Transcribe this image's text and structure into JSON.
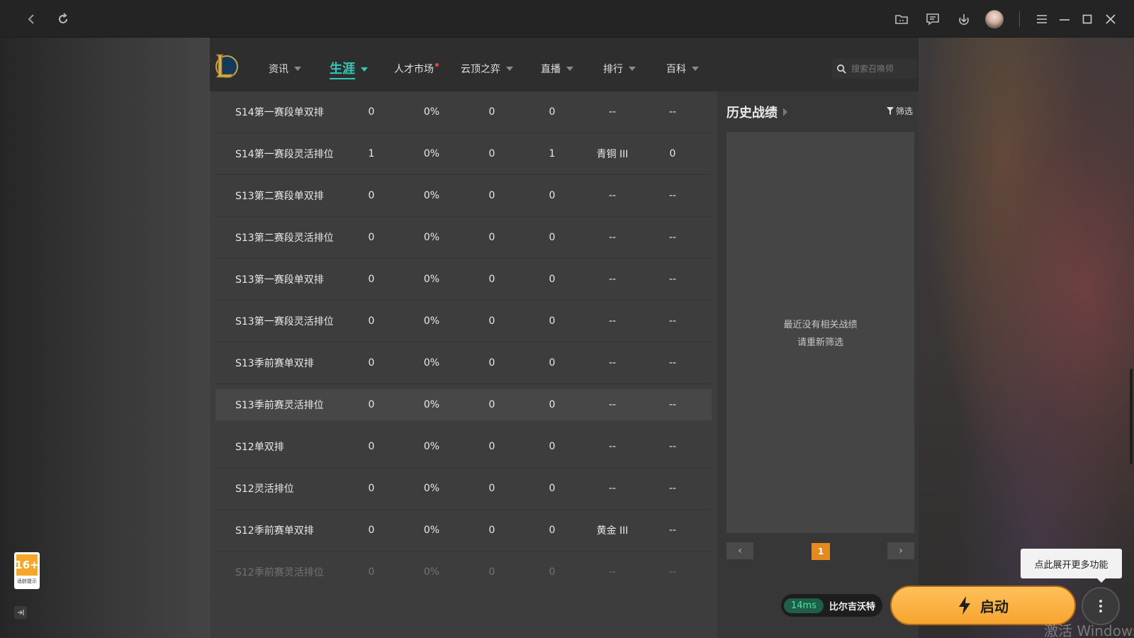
{
  "titlebar": {
    "icons": [
      "back-icon",
      "refresh-icon",
      "folder-icon",
      "message-icon",
      "download-icon",
      "avatar",
      "menu-icon",
      "minimize-icon",
      "maximize-icon",
      "close-icon"
    ]
  },
  "nav": {
    "items": [
      {
        "label": "资讯",
        "has_caret": true
      },
      {
        "label": "生涯",
        "has_caret": true,
        "active": true
      },
      {
        "label": "人才市场",
        "has_caret": false,
        "dot": true
      },
      {
        "label": "云顶之弈",
        "has_caret": true
      },
      {
        "label": "直播",
        "has_caret": true
      },
      {
        "label": "排行",
        "has_caret": true
      },
      {
        "label": "百科",
        "has_caret": true
      }
    ],
    "search_placeholder": "搜索召唤师"
  },
  "table": {
    "rows": [
      {
        "season": "S14第一赛段单双排",
        "a": "0",
        "b": "0%",
        "c": "0",
        "d": "0",
        "rank": "--",
        "e": "--"
      },
      {
        "season": "S14第一赛段灵活排位",
        "a": "1",
        "b": "0%",
        "c": "0",
        "d": "1",
        "rank": "青铜 III",
        "e": "0"
      },
      {
        "season": "S13第二赛段单双排",
        "a": "0",
        "b": "0%",
        "c": "0",
        "d": "0",
        "rank": "--",
        "e": "--"
      },
      {
        "season": "S13第二赛段灵活排位",
        "a": "0",
        "b": "0%",
        "c": "0",
        "d": "0",
        "rank": "--",
        "e": "--"
      },
      {
        "season": "S13第一赛段单双排",
        "a": "0",
        "b": "0%",
        "c": "0",
        "d": "0",
        "rank": "--",
        "e": "--"
      },
      {
        "season": "S13第一赛段灵活排位",
        "a": "0",
        "b": "0%",
        "c": "0",
        "d": "0",
        "rank": "--",
        "e": "--"
      },
      {
        "season": "S13季前赛单双排",
        "a": "0",
        "b": "0%",
        "c": "0",
        "d": "0",
        "rank": "--",
        "e": "--"
      },
      {
        "season": "S13季前赛灵活排位",
        "a": "0",
        "b": "0%",
        "c": "0",
        "d": "0",
        "rank": "--",
        "e": "--",
        "highlight": true
      },
      {
        "season": "S12单双排",
        "a": "0",
        "b": "0%",
        "c": "0",
        "d": "0",
        "rank": "--",
        "e": "--"
      },
      {
        "season": "S12灵活排位",
        "a": "0",
        "b": "0%",
        "c": "0",
        "d": "0",
        "rank": "--",
        "e": "--"
      },
      {
        "season": "S12季前赛单双排",
        "a": "0",
        "b": "0%",
        "c": "0",
        "d": "0",
        "rank": "黄金 III",
        "e": "--"
      },
      {
        "season": "S12季前赛灵活排位",
        "a": "0",
        "b": "0%",
        "c": "0",
        "d": "0",
        "rank": "--",
        "e": "--",
        "faded": true
      }
    ]
  },
  "history": {
    "title": "历史战绩",
    "filter_label": "筛选",
    "empty_line1": "最近没有相关战绩",
    "empty_line2": "请重新筛选",
    "page": "1",
    "prev": "‹",
    "next": "›"
  },
  "bottom": {
    "ping": "14ms",
    "server": "比尔吉沃特",
    "launch_label": "启动",
    "tooltip": "点此展开更多功能",
    "watermark": "激活 Windows"
  },
  "age_badge": {
    "rating": "16+",
    "caption": "适龄提示"
  },
  "colors": {
    "accent": "#34c7b7",
    "launch": "#f7a530",
    "page_active": "#e58a1f",
    "ping_text": "#52e0a6"
  }
}
